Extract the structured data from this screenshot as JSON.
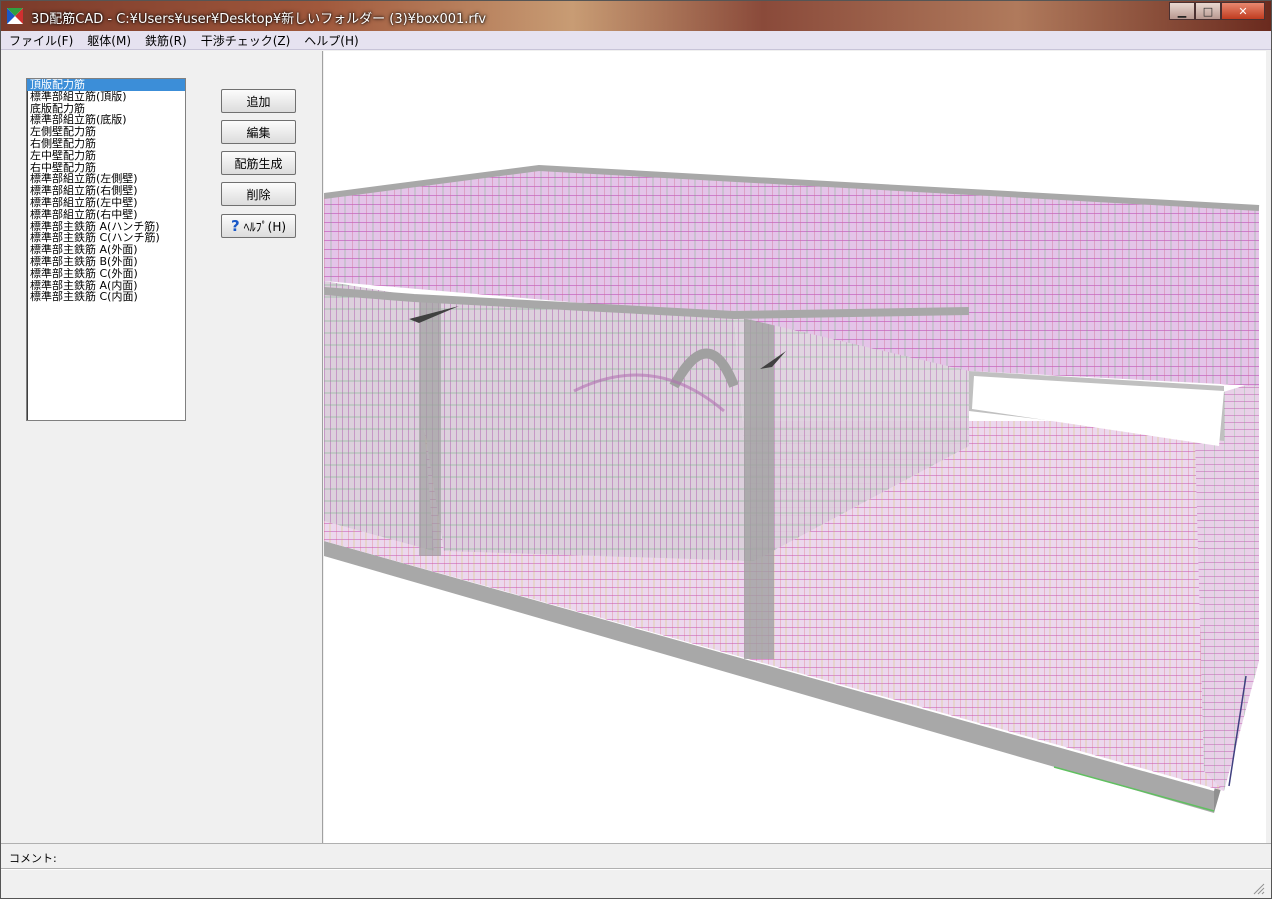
{
  "window": {
    "title": "3D配筋CAD - C:¥Users¥user¥Desktop¥新しいフォルダー (3)¥box001.rfv",
    "minimize_label": "▁",
    "maximize_label": "□",
    "close_label": "✕"
  },
  "menu": [
    "ファイル(F)",
    "躯体(M)",
    "鉄筋(R)",
    "干渉チェック(Z)",
    "ヘルプ(H)"
  ],
  "rebar_list": {
    "items": [
      "頂版配力筋",
      "標準部組立筋(頂版)",
      "底版配力筋",
      "標準部組立筋(底版)",
      "左側壁配力筋",
      "右側壁配力筋",
      "左中壁配力筋",
      "右中壁配力筋",
      "標準部組立筋(左側壁)",
      "標準部組立筋(右側壁)",
      "標準部組立筋(左中壁)",
      "標準部組立筋(右中壁)",
      "標準部主鉄筋 A(ハンチ筋)",
      "標準部主鉄筋 C(ハンチ筋)",
      "標準部主鉄筋 A(外面)",
      "標準部主鉄筋 B(外面)",
      "標準部主鉄筋 C(外面)",
      "標準部主鉄筋 A(内面)",
      "標準部主鉄筋 C(内面)"
    ],
    "selected_index": 0
  },
  "buttons": {
    "add": "追加",
    "edit": "編集",
    "generate": "配筋生成",
    "delete": "削除",
    "help": "ﾍﾙﾌﾟ(H)"
  },
  "status": {
    "comment_label": "コメント:"
  },
  "colors": {
    "selection": "#3c8ed8",
    "rebar_magenta": "#d060c0",
    "rebar_red": "#e05050",
    "rebar_green": "#50c060",
    "concrete": "#a8a8a8"
  }
}
